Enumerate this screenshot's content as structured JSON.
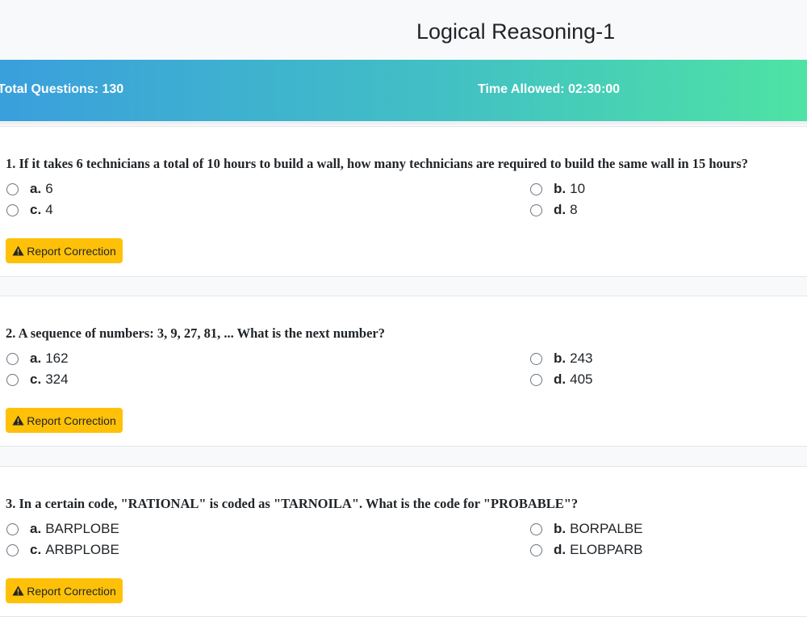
{
  "page": {
    "title": "Logical Reasoning-1"
  },
  "info": {
    "total_questions": "Total Questions: 130",
    "time_allowed": "Time Allowed: 02:30:00"
  },
  "questions": [
    {
      "text": "1. If it takes 6 technicians a total of 10 hours to build a wall, how many technicians are required to build the same wall in 15 hours?",
      "options": [
        {
          "letter": "a.",
          "value": "6"
        },
        {
          "letter": "b.",
          "value": "10"
        },
        {
          "letter": "c.",
          "value": "4"
        },
        {
          "letter": "d.",
          "value": "8"
        }
      ],
      "report_label": "Report Correction"
    },
    {
      "text": "2. A sequence of numbers: 3, 9, 27, 81, ... What is the next number?",
      "options": [
        {
          "letter": "a.",
          "value": "162"
        },
        {
          "letter": "b.",
          "value": "243"
        },
        {
          "letter": "c.",
          "value": "324"
        },
        {
          "letter": "d.",
          "value": "405"
        }
      ],
      "report_label": "Report Correction"
    },
    {
      "text": "3. In a certain code, \"RATIONAL\" is coded as \"TARNOILA\". What is the code for \"PROBABLE\"?",
      "options": [
        {
          "letter": "a.",
          "value": "BARPLOBE"
        },
        {
          "letter": "b.",
          "value": "BORPALBE"
        },
        {
          "letter": "c.",
          "value": "ARBPLOBE"
        },
        {
          "letter": "d.",
          "value": "ELOBPARB"
        }
      ],
      "report_label": "Report Correction"
    }
  ],
  "colors": {
    "accent_start": "#3a9fdd",
    "accent_end": "#4ee3a4",
    "report_button": "#ffc107"
  },
  "icons": {
    "report": "warning-triangle-icon"
  }
}
